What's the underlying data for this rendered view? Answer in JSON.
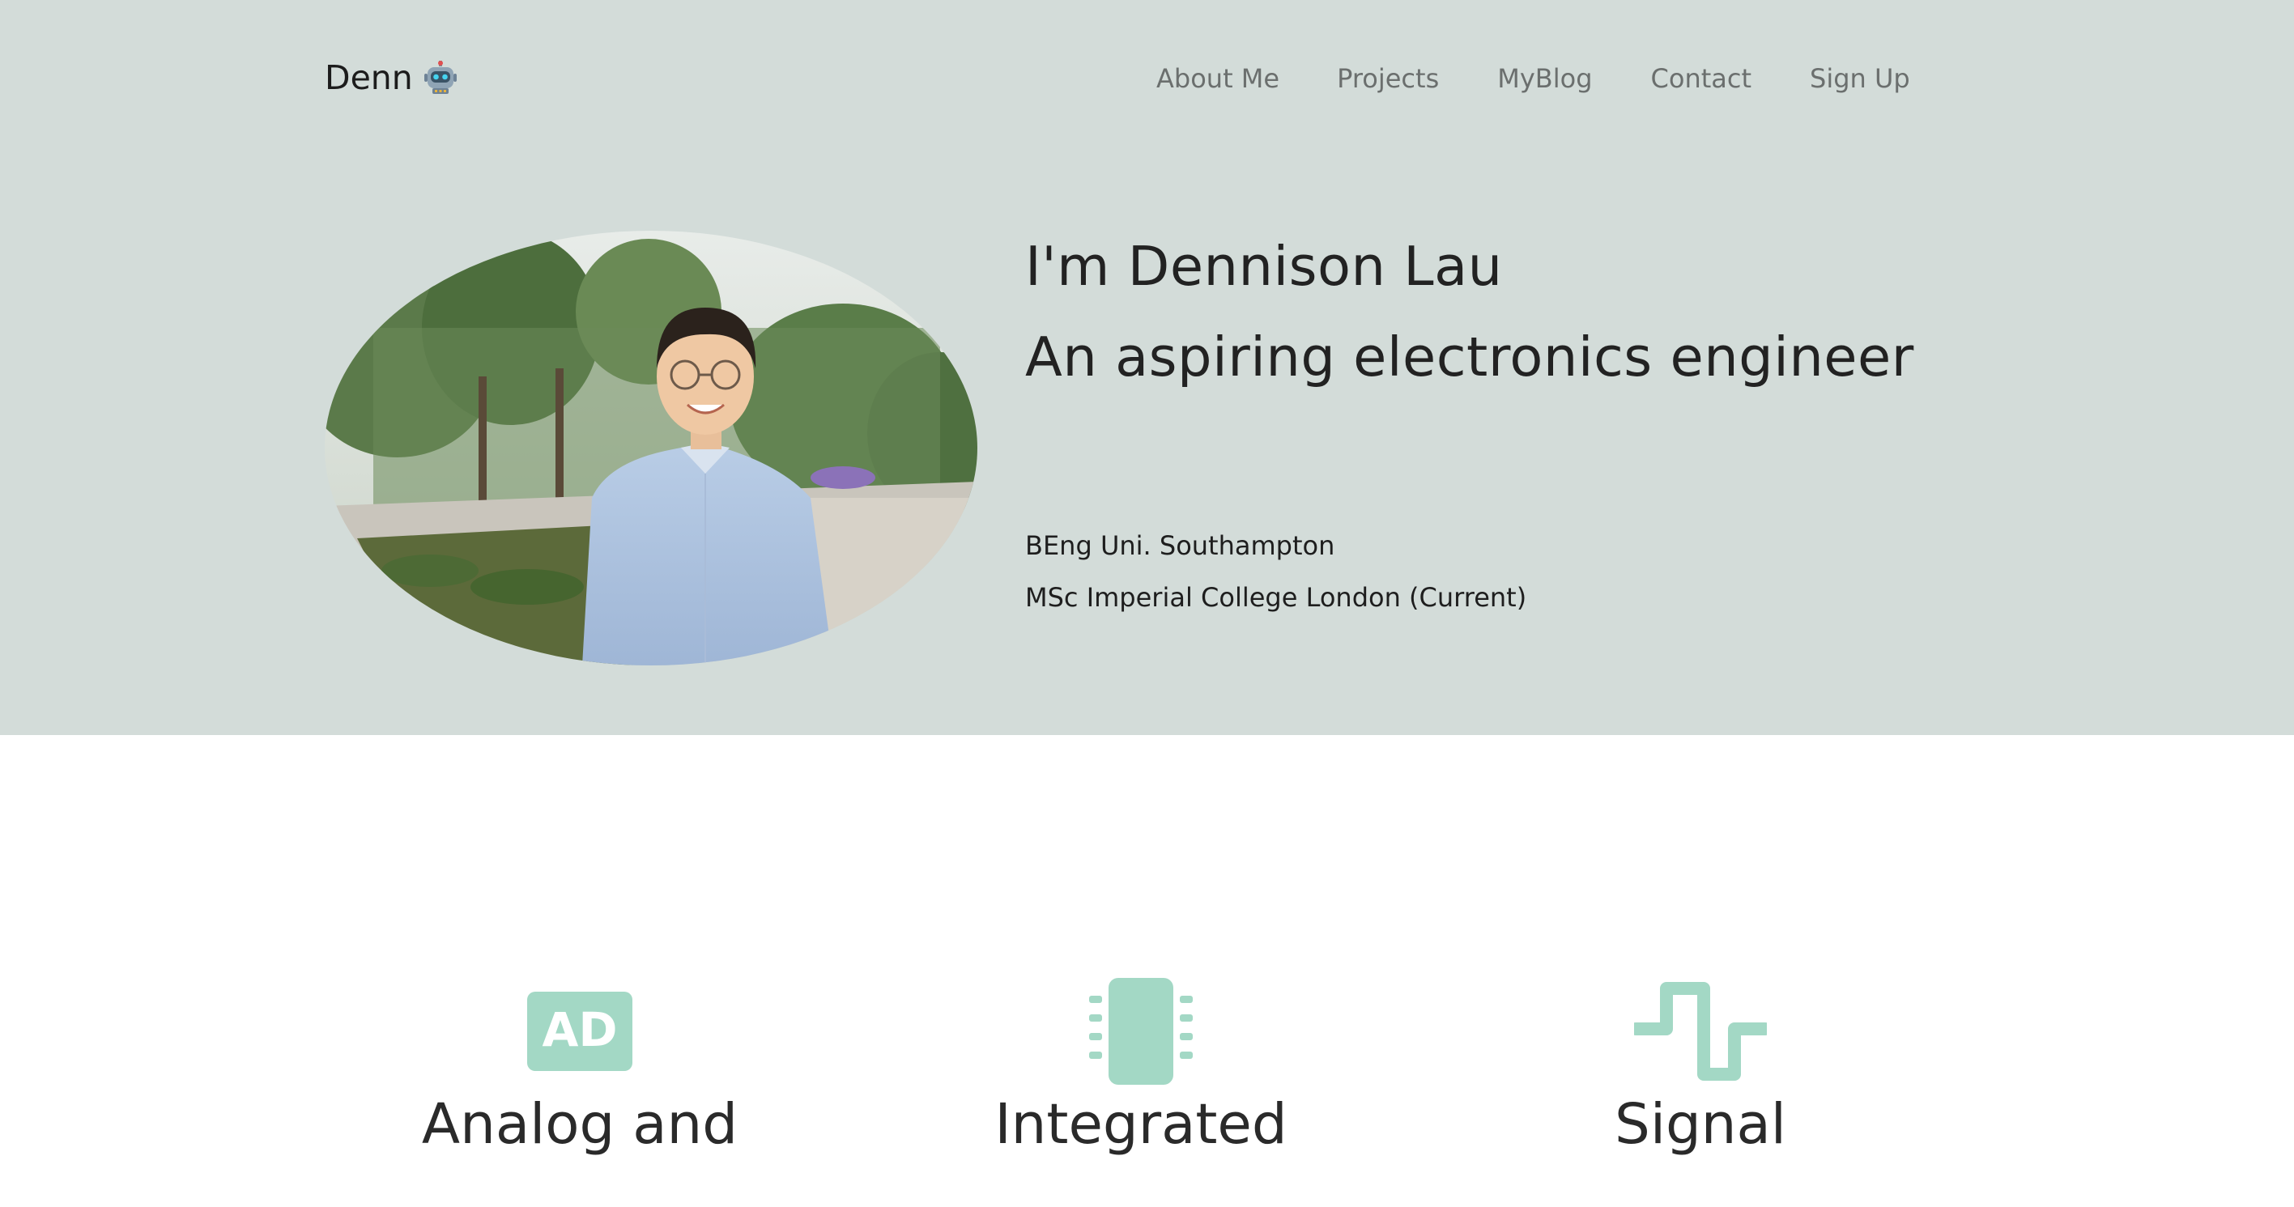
{
  "brand": {
    "name": "Denn",
    "icon": "robot-icon"
  },
  "nav": {
    "items": [
      {
        "label": "About Me"
      },
      {
        "label": "Projects"
      },
      {
        "label": "MyBlog"
      },
      {
        "label": "Contact"
      },
      {
        "label": "Sign Up"
      }
    ]
  },
  "hero": {
    "heading": "I'm Dennison Lau",
    "subheading": "An aspiring electronics engineer",
    "education": [
      "BEng Uni. Southampton",
      "MSc Imperial College London (Current)"
    ],
    "photo": "profile-photo"
  },
  "features": [
    {
      "icon": "analog-digital-icon",
      "icon_text": "AD",
      "title": "Analog and"
    },
    {
      "icon": "chip-icon",
      "title": "Integrated"
    },
    {
      "icon": "square-wave-icon",
      "title": "Signal"
    }
  ],
  "colors": {
    "hero_bg": "#d3dcd9",
    "accent": "#a3d8c5",
    "nav_text": "#6b6f6e"
  }
}
